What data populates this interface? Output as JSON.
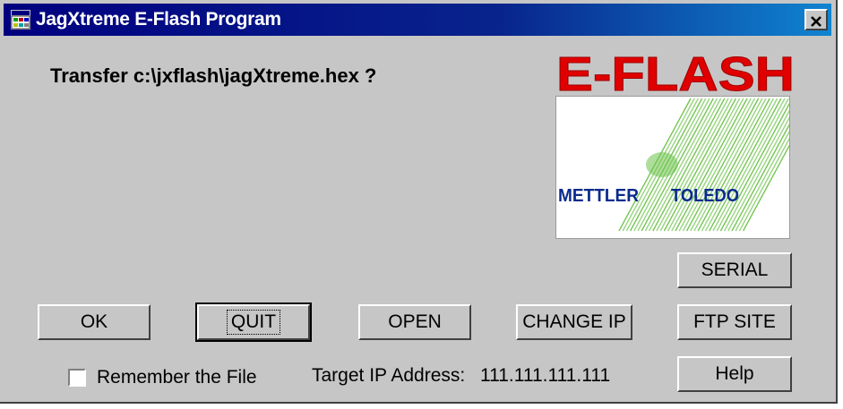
{
  "window": {
    "title": "JagXtreme E-Flash Program",
    "title_bar_color": "#000080",
    "close_icon": "close-icon"
  },
  "prompt": "Transfer c:\\jxflash\\jagXtreme.hex ?",
  "logo": {
    "heading": "E-FLASH",
    "heading_color": "#e00000",
    "brand_left": "METTLER",
    "brand_right": "TOLEDO",
    "brand_color": "#0a2a8c",
    "graphic_color": "#6cc24a"
  },
  "buttons": {
    "ok": "OK",
    "quit": "QUIT",
    "open": "OPEN",
    "change_ip": "CHANGE IP",
    "serial": "SERIAL",
    "ftp_site": "FTP SITE",
    "help": "Help"
  },
  "remember_file": {
    "label": "Remember the File",
    "checked": false
  },
  "target_ip": {
    "label": "Target IP Address:",
    "value": "111.111.111.111"
  }
}
